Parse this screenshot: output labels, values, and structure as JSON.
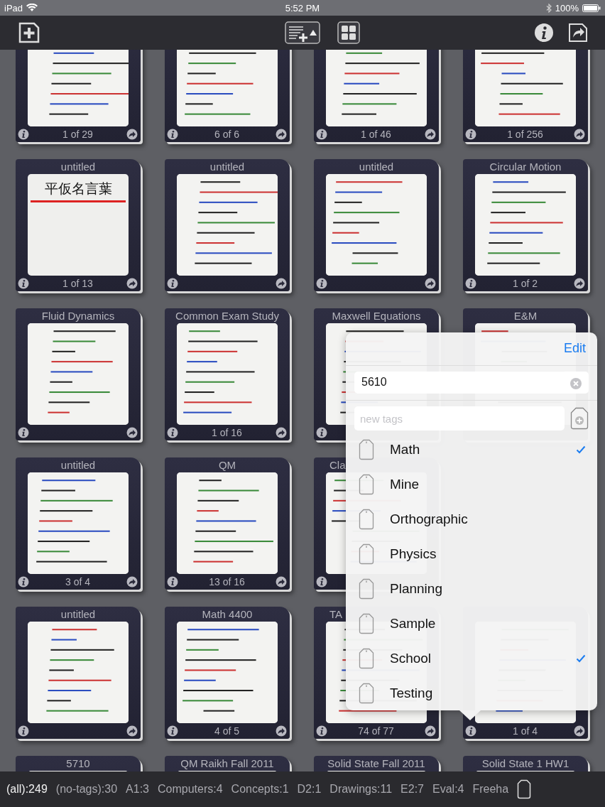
{
  "status_bar": {
    "device": "iPad",
    "time": "5:52 PM",
    "battery": "100%"
  },
  "notes": [
    {
      "kind": "note",
      "count": "1 of 29"
    },
    {
      "kind": "note",
      "count": "6 of 6"
    },
    {
      "kind": "note",
      "count": "1 of 46"
    },
    {
      "kind": "note",
      "count": "1 of 256"
    },
    {
      "kind": "note",
      "title": "untitled",
      "count": "1 of 13",
      "thumb_text": "平仮名言葉"
    },
    {
      "kind": "note",
      "title": "untitled"
    },
    {
      "kind": "note",
      "title": "untitled"
    },
    {
      "kind": "note",
      "title": "Circular Motion",
      "count": "1 of 2"
    },
    {
      "kind": "note",
      "title": "Fluid Dynamics"
    },
    {
      "kind": "note",
      "title": "Common Exam Study",
      "count": "1 of 16"
    },
    {
      "kind": "right_covered",
      "title": "Maxwell Equations"
    },
    {
      "kind": "top_only",
      "title": "E&M"
    },
    {
      "kind": "note",
      "title": "untitled",
      "count": "3 of 4"
    },
    {
      "kind": "note",
      "title": "QM",
      "count": "13 of 16"
    },
    {
      "kind": "left_strip",
      "title": "Cla"
    },
    {
      "kind": "covered"
    },
    {
      "kind": "note",
      "title": "untitled"
    },
    {
      "kind": "note",
      "title": "Math 4400",
      "count": "4 of 5"
    },
    {
      "kind": "title_covered",
      "title": "TA",
      "count": "74 of 77"
    },
    {
      "kind": "note",
      "count": "1 of 4"
    },
    {
      "kind": "note",
      "title": "5710"
    },
    {
      "kind": "note",
      "title": "QM Raikh Fall 2011"
    },
    {
      "kind": "note",
      "title": "Solid State Fall 2011"
    },
    {
      "kind": "note",
      "title": "Solid State 1 HW1"
    }
  ],
  "tag_popover": {
    "edit": "Edit",
    "search_value": "5610",
    "new_tag_placeholder": "new tags",
    "tags": [
      {
        "label": "Math",
        "checked": true
      },
      {
        "label": "Mine",
        "checked": false
      },
      {
        "label": "Orthographic",
        "checked": false
      },
      {
        "label": "Physics",
        "checked": false
      },
      {
        "label": "Planning",
        "checked": false
      },
      {
        "label": "Sample",
        "checked": false
      },
      {
        "label": "School",
        "checked": true
      },
      {
        "label": "Testing",
        "checked": false
      }
    ]
  },
  "tag_bar": [
    {
      "label": "(all):249",
      "selected": true
    },
    {
      "label": "(no-tags):30",
      "selected": false
    },
    {
      "label": "A1:3",
      "selected": false
    },
    {
      "label": "Computers:4",
      "selected": false
    },
    {
      "label": "Concepts:1",
      "selected": false
    },
    {
      "label": "D2:1",
      "selected": false
    },
    {
      "label": "Drawings:11",
      "selected": false
    },
    {
      "label": "E2:7",
      "selected": false
    },
    {
      "label": "Eval:4",
      "selected": false
    },
    {
      "label": "Freeha",
      "selected": false
    }
  ]
}
